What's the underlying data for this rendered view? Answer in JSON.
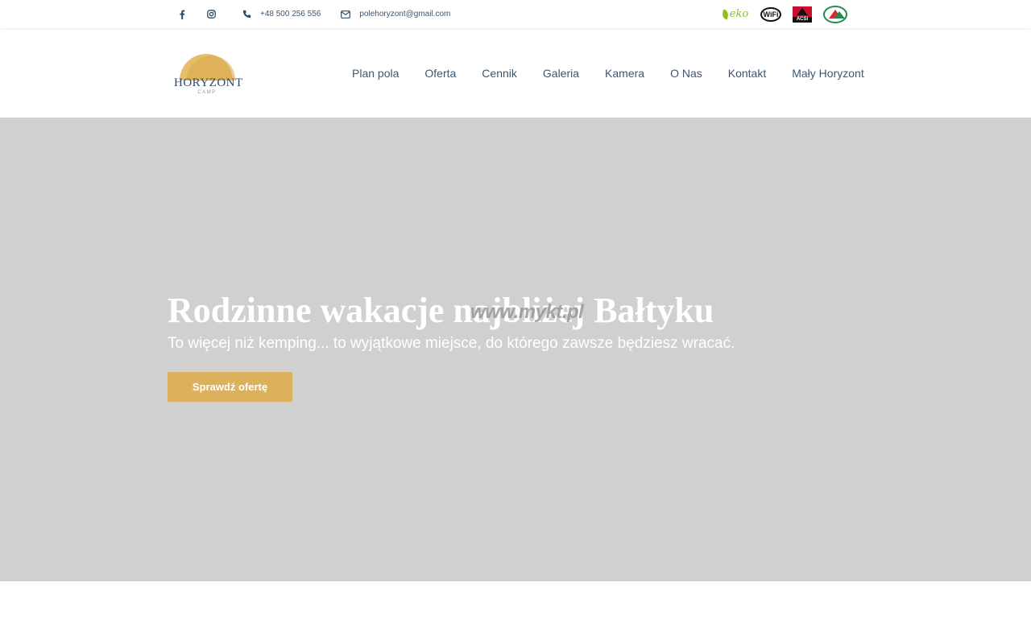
{
  "topbar": {
    "icons": {
      "facebook": "facebook-icon",
      "instagram": "instagram-icon",
      "phone": "phone-icon",
      "mail": "envelope-icon"
    },
    "phone": "+48 500 256 556",
    "email": "polehoryzont@gmail.com",
    "badges": {
      "eko": "eko",
      "wifi": "WiFi",
      "acsi": "ACSI"
    }
  },
  "header": {
    "logo": {
      "name": "HORYZONT",
      "sub": "CAMP"
    },
    "nav": [
      "Plan pola",
      "Oferta",
      "Cennik",
      "Galeria",
      "Kamera",
      "O Nas",
      "Kontakt",
      "Mały Horyzont"
    ]
  },
  "hero": {
    "title": "Rodzinne wakacje najbliżej Bałtyku",
    "subtitle": "To więcej niż kemping... to wyjątkowe miejsce, do którego zawsze będziesz wracać.",
    "button_label": "Sprawdź ofertę",
    "watermark": "www.mykt.pl"
  },
  "colors": {
    "accent": "#ddb05c",
    "text": "#3d5670",
    "hero_bg": "#d0d0d0"
  }
}
